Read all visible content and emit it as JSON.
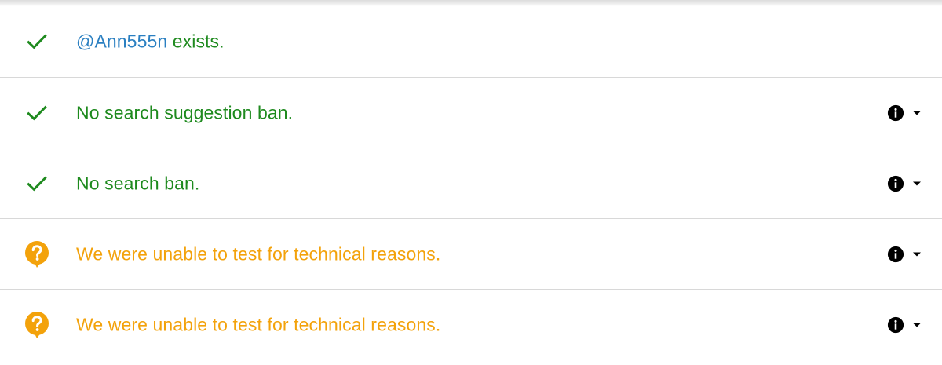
{
  "results": [
    {
      "status": "ok",
      "icon": "check-icon",
      "handle": "@Ann555n",
      "text": " exists.",
      "has_info": false
    },
    {
      "status": "ok",
      "icon": "check-icon",
      "text": "No search suggestion ban.",
      "has_info": true
    },
    {
      "status": "ok",
      "icon": "check-icon",
      "text": "No search ban.",
      "has_info": true
    },
    {
      "status": "warn",
      "icon": "help-bubble-icon",
      "text": "We were unable to test for technical reasons.",
      "has_info": true
    },
    {
      "status": "warn",
      "icon": "help-bubble-icon",
      "text": "We were unable to test for technical reasons.",
      "has_info": true
    }
  ],
  "colors": {
    "ok": "#1e8a1e",
    "warn": "#f3a20b",
    "link": "#2a7fc1",
    "divider": "#d8d8d8"
  }
}
